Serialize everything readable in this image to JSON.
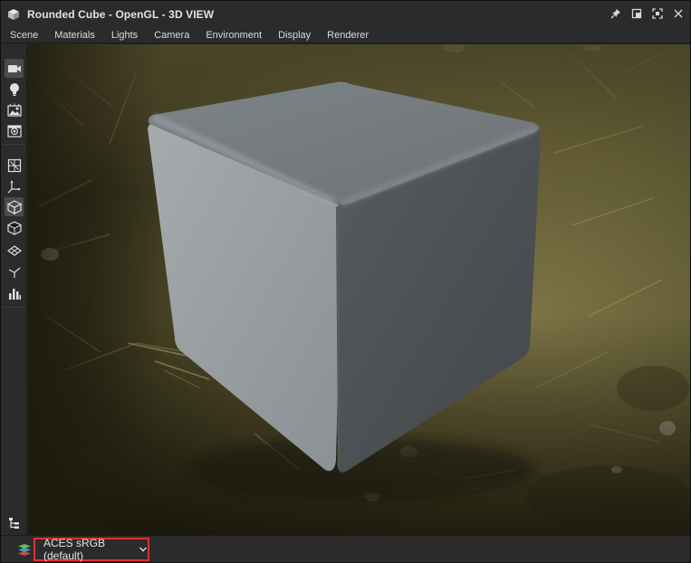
{
  "window": {
    "title": "Rounded Cube - OpenGL - 3D VIEW",
    "icon": "cube-icon",
    "controls": [
      "pin-icon",
      "restore-icon",
      "maximize-icon",
      "close-icon"
    ]
  },
  "menubar": {
    "items": [
      {
        "label": "Scene"
      },
      {
        "label": "Materials"
      },
      {
        "label": "Lights"
      },
      {
        "label": "Camera"
      },
      {
        "label": "Environment"
      },
      {
        "label": "Display"
      },
      {
        "label": "Renderer"
      }
    ]
  },
  "toolbar": {
    "tools": [
      {
        "name": "camera-icon",
        "active": true
      },
      {
        "name": "light-bulb-icon",
        "active": false
      },
      {
        "name": "environment-icon",
        "active": false
      },
      {
        "name": "screenshot-icon",
        "active": false
      },
      {
        "name": "view-cube-grid-icon",
        "active": false
      },
      {
        "name": "axis-gizmo-icon",
        "active": false
      },
      {
        "name": "solid-cube-icon",
        "active": true
      },
      {
        "name": "wireframe-cube-icon",
        "active": false
      },
      {
        "name": "ground-plane-icon",
        "active": false
      },
      {
        "name": "tangent-vectors-icon",
        "active": false
      },
      {
        "name": "histogram-icon",
        "active": false
      },
      {
        "name": "hierarchy-icon",
        "active": false
      }
    ]
  },
  "statusbar": {
    "layers_icon": "layers-icon",
    "color_space": "ACES sRGB (default)",
    "highlight_color": "#e0302f"
  },
  "viewport": {
    "object": "rounded cube",
    "background": "grass environment"
  }
}
